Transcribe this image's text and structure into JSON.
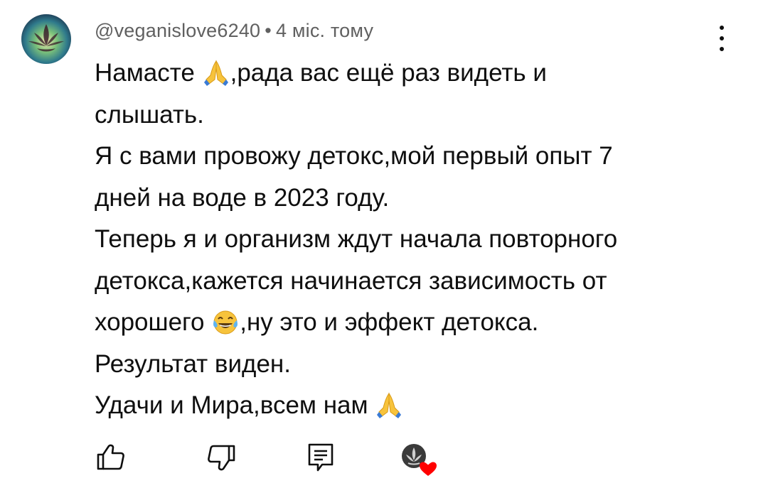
{
  "comment": {
    "author": "@veganislove6240",
    "separator": "•",
    "time": "4 міс. тому",
    "lines": [
      {
        "before": "Намасте ",
        "emoji": "folded-hands-emoji",
        "after": ",рада вас ещё раз видеть и"
      },
      {
        "before": "слышать.",
        "emoji": "",
        "after": ""
      },
      {
        "before": "Я  с вами провожу детокс,мой первый опыт 7",
        "emoji": "",
        "after": ""
      },
      {
        "before": "дней на воде в 2023 году.",
        "emoji": "",
        "after": ""
      },
      {
        "before": "Теперь я и организм ждут начала повторного",
        "emoji": "",
        "after": ""
      },
      {
        "before": "детокса,кажется начинается зависимость от",
        "emoji": "",
        "after": ""
      },
      {
        "before": "хорошего ",
        "emoji": "tears-of-joy-emoji",
        "after": ",ну это и эффект детокса."
      },
      {
        "before": "Результат виден.",
        "emoji": "",
        "after": ""
      },
      {
        "before": "Удачи и Мира,всем нам ",
        "emoji": "folded-hands-emoji",
        "after": ""
      }
    ]
  },
  "actions": [
    {
      "name": "like-button",
      "icon": "thumbs-up-icon"
    },
    {
      "name": "dislike-button",
      "icon": "thumbs-down-icon"
    },
    {
      "name": "reply-button",
      "icon": "reply-icon"
    },
    {
      "name": "creator-heart-badge",
      "icon": "creator-heart-icon"
    }
  ],
  "colors": {
    "text": "#0f0f0f",
    "meta": "#606060",
    "heart": "#ff0000"
  }
}
